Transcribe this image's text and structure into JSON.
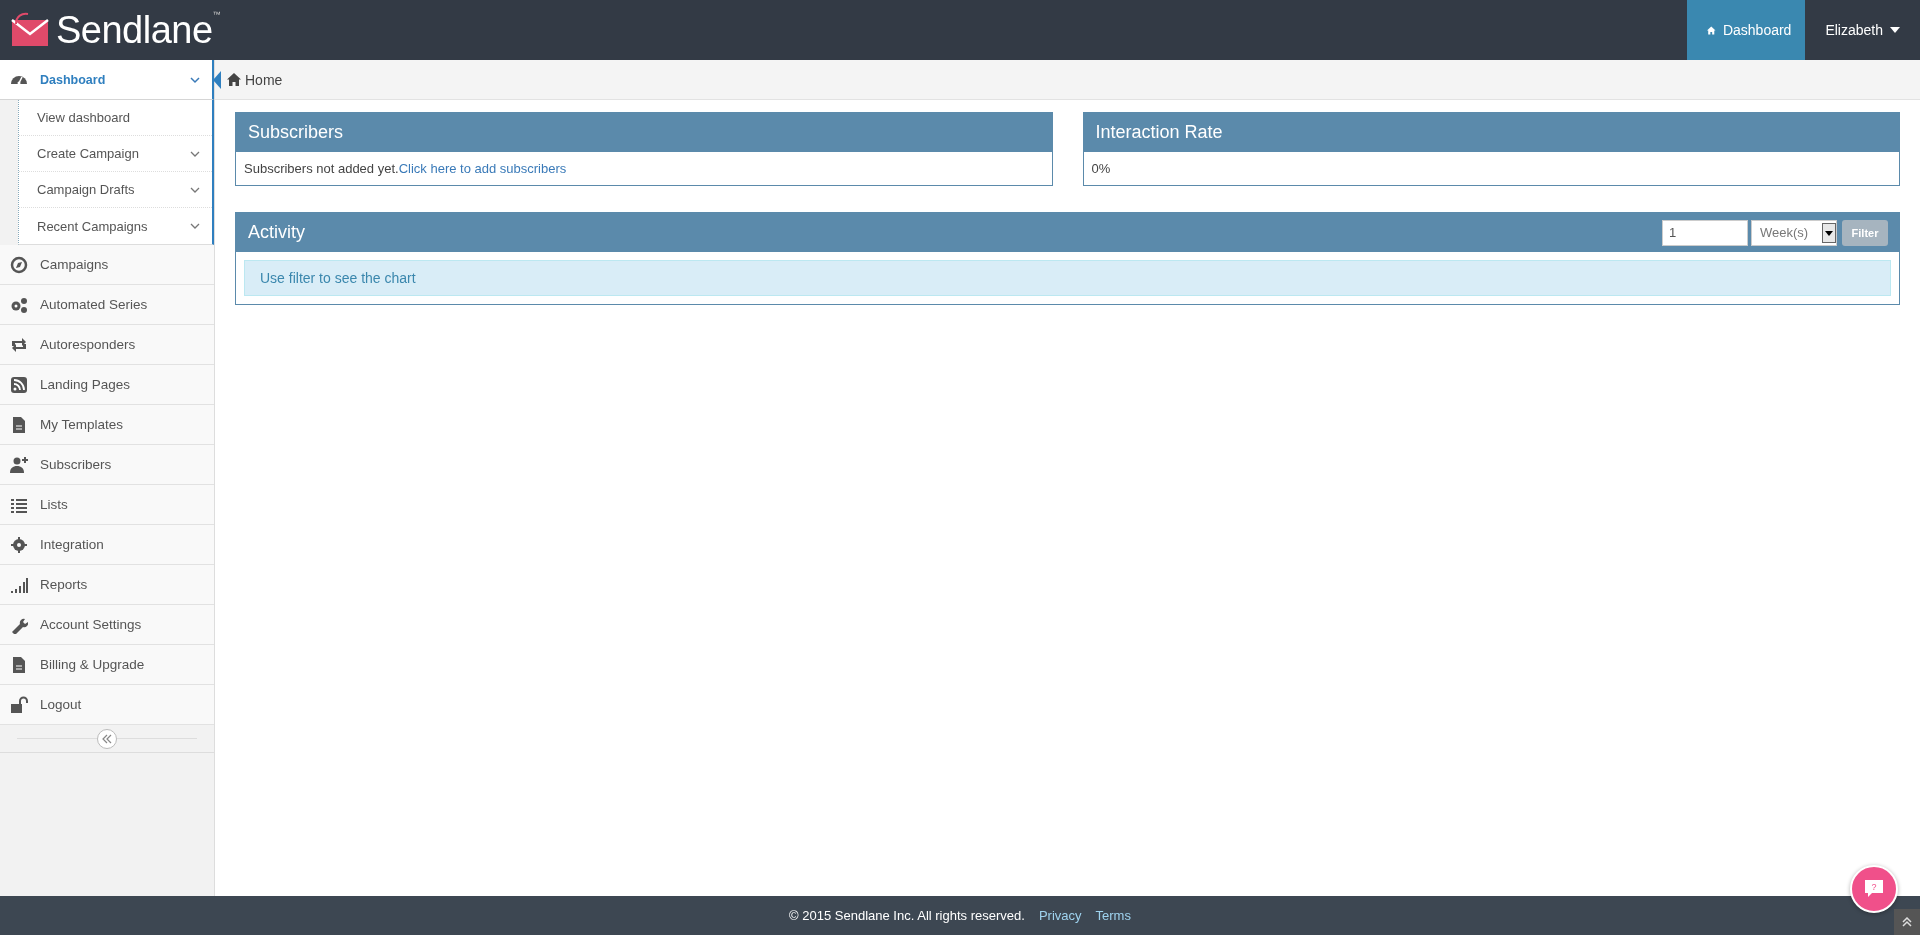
{
  "header": {
    "logo": "Sendlane",
    "trademark": "™",
    "nav": [
      {
        "label": "Dashboard",
        "selected": true,
        "kind": "home"
      },
      {
        "label": "Elizabeth",
        "selected": false,
        "kind": "dropdown"
      }
    ]
  },
  "sidebar": {
    "items": [
      {
        "label": "Dashboard",
        "selected": true,
        "expanded": true,
        "children": [
          {
            "label": "View dashboard",
            "kind": "link"
          },
          {
            "label": "Create Campaign",
            "kind": "submenu"
          },
          {
            "label": "Campaign Drafts",
            "kind": "submenu"
          },
          {
            "label": "Recent Campaigns",
            "kind": "submenu"
          }
        ]
      },
      {
        "label": "Campaigns",
        "selected": false
      },
      {
        "label": "Automated Series",
        "selected": false
      },
      {
        "label": "Autoresponders",
        "selected": false
      },
      {
        "label": "Landing Pages",
        "selected": false
      },
      {
        "label": "My Templates",
        "selected": false
      },
      {
        "label": "Subscribers",
        "selected": false
      },
      {
        "label": "Lists",
        "selected": false
      },
      {
        "label": "Integration",
        "selected": false
      },
      {
        "label": "Reports",
        "selected": false
      },
      {
        "label": "Account Settings",
        "selected": false
      },
      {
        "label": "Billing & Upgrade",
        "selected": false
      },
      {
        "label": "Logout",
        "selected": false
      }
    ]
  },
  "breadcrumb": "Home",
  "panels": [
    {
      "title": "Subscribers",
      "text": "Subscribers not added yet.",
      "link": "Click here to add subscribers"
    },
    {
      "title": "Interaction Rate",
      "text": "0%"
    }
  ],
  "activity": {
    "title": "Activity",
    "filter_value": "1",
    "period": "Week(s)",
    "filter_button": "Filter",
    "message": "Use filter to see the chart"
  },
  "footer": {
    "copyright": "© 2015 Sendlane Inc. All rights reserved.",
    "links": [
      "Privacy",
      "Terms"
    ]
  },
  "help": {
    "label": "?"
  }
}
